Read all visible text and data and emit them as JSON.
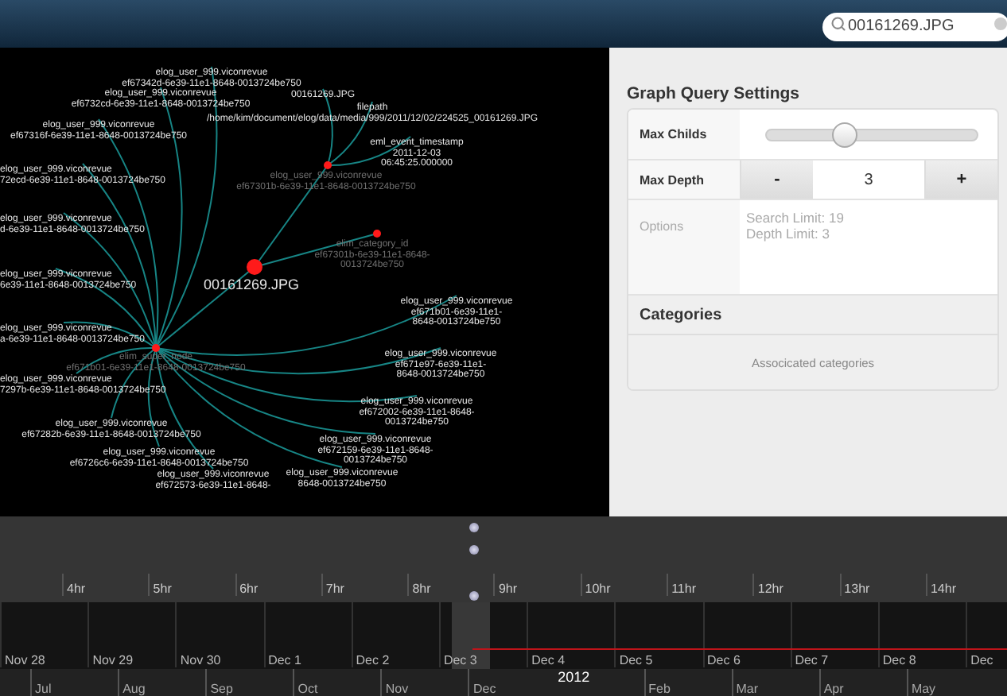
{
  "header": {
    "search": {
      "value": "00161269.JPG"
    }
  },
  "graph": {
    "root": {
      "dimmed": false,
      "lines": [
        "00161269.JPG"
      ],
      "children": [
        {
          "dimmed": true,
          "lines": [
            "elog_user_999.viconrevue",
            "ef67301b-6e39-11e1-8648-0013724be750"
          ],
          "children": [
            {
              "dimmed": false,
              "lines": [
                "00161269.JPG"
              ]
            },
            {
              "dimmed": false,
              "lines": [
                "filepath",
                "/home/kim/document/elog/data/media/999/2011/12/02/224525_00161269.JPG"
              ]
            },
            {
              "dimmed": false,
              "lines": [
                "eml_event_timestamp",
                "2011-12-03",
                "06:45:25.000000"
              ]
            }
          ]
        },
        {
          "dimmed": true,
          "lines": [
            "elim_category_id",
            "ef67301b-6e39-11e1-8648-",
            "0013724be750"
          ]
        },
        {
          "dimmed": true,
          "lines": [
            "elim_super_node",
            "ef671b01-6e39-11e1-8648-0013724be750"
          ],
          "children": [
            {
              "dimmed": false,
              "lines": [
                "elog_user_999.viconrevue",
                "ef67342d-6e39-11e1-8648-0013724be750"
              ]
            },
            {
              "dimmed": false,
              "lines": [
                "elog_user_999.viconrevue",
                "ef6732cd-6e39-11e1-8648-0013724be750"
              ]
            },
            {
              "dimmed": false,
              "lines": [
                "elog_user_999.viconrevue",
                "ef67316f-6e39-11e1-8648-0013724be750"
              ]
            },
            {
              "dimmed": false,
              "lines": [
                "elog_user_999.viconrevue",
                "72ecd-6e39-11e1-8648-0013724be750"
              ]
            },
            {
              "dimmed": false,
              "lines": [
                "elog_user_999.viconrevue",
                "d-6e39-11e1-8648-0013724be750"
              ]
            },
            {
              "dimmed": false,
              "lines": [
                "elog_user_999.viconrevue",
                "6e39-11e1-8648-0013724be750"
              ]
            },
            {
              "dimmed": false,
              "lines": [
                "elog_user_999.viconrevue",
                "a-6e39-11e1-8648-0013724be750"
              ]
            },
            {
              "dimmed": false,
              "lines": [
                "elog_user_999.viconrevue",
                "7297b-6e39-11e1-8648-0013724be750"
              ]
            },
            {
              "dimmed": false,
              "lines": [
                "elog_user_999.viconrevue",
                "ef67282b-6e39-11e1-8648-0013724be750"
              ]
            },
            {
              "dimmed": false,
              "lines": [
                "elog_user_999.viconrevue",
                "ef6726c6-6e39-11e1-8648-0013724be750"
              ]
            },
            {
              "dimmed": false,
              "lines": [
                "elog_user_999.viconrevue",
                "ef672573-6e39-11e1-8648-"
              ]
            },
            {
              "dimmed": false,
              "lines": [
                "elog_user_999.viconrevue",
                "ef671b01-6e39-11e1-",
                "8648-0013724be750"
              ]
            },
            {
              "dimmed": false,
              "lines": [
                "elog_user_999.viconrevue",
                "ef671e97-6e39-11e1-",
                "8648-0013724be750"
              ]
            },
            {
              "dimmed": false,
              "lines": [
                "elog_user_999.viconrevue",
                "ef672002-6e39-11e1-8648-",
                "0013724be750"
              ]
            },
            {
              "dimmed": false,
              "lines": [
                "elog_user_999.viconrevue",
                "ef672159-6e39-11e1-8648-",
                "0013724be750"
              ]
            },
            {
              "dimmed": false,
              "lines": [
                "elog_user_999.viconrevue",
                "8648-0013724be750"
              ]
            }
          ]
        }
      ]
    }
  },
  "settings": {
    "title": "Graph Query Settings",
    "max_childs": {
      "label": "Max Childs",
      "level": 0.37
    },
    "max_depth": {
      "label": "Max Depth",
      "decrement": "-",
      "value": "3",
      "increment": "+"
    },
    "options": {
      "label": "Options",
      "placeholder": "Search Limit: 19\nDepth Limit: 3"
    },
    "categories": {
      "title": "Categories",
      "empty_text": "Associcated categories"
    }
  },
  "timeline": {
    "hours": [
      "4hr",
      "5hr",
      "6hr",
      "7hr",
      "8hr",
      "9hr",
      "10hr",
      "11hr",
      "12hr",
      "13hr",
      "14hr"
    ],
    "days": [
      "Nov 28",
      "Nov 29",
      "Nov 30",
      "Dec 1",
      "Dec 2",
      "Dec 3",
      "Dec 4",
      "Dec 5",
      "Dec 6",
      "Dec 7",
      "Dec 8",
      "Dec"
    ],
    "months": [
      {
        "kind": "month",
        "label": "Jul"
      },
      {
        "kind": "month",
        "label": "Aug"
      },
      {
        "kind": "month",
        "label": "Sep"
      },
      {
        "kind": "month",
        "label": "Oct"
      },
      {
        "kind": "month",
        "label": "Nov"
      },
      {
        "kind": "month",
        "label": "Dec"
      },
      {
        "kind": "year",
        "label": "2012"
      },
      {
        "kind": "month",
        "label": "Feb"
      },
      {
        "kind": "month",
        "label": "Mar"
      },
      {
        "kind": "month",
        "label": "Apr"
      },
      {
        "kind": "month",
        "label": "May"
      }
    ]
  }
}
